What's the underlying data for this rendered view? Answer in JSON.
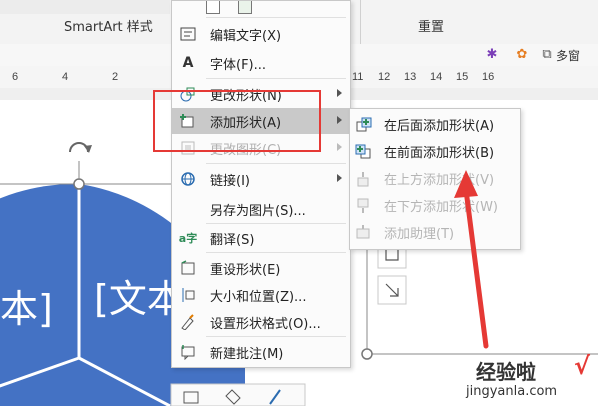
{
  "ribbon": {
    "group_smartart_styles": "SmartArt 样式",
    "group_reset": "重置",
    "more_windows": "多窗"
  },
  "ruler": {
    "left_ticks": [
      "6",
      "4",
      "2"
    ],
    "right_ticks": [
      "11",
      "12",
      "13",
      "14",
      "15",
      "16"
    ]
  },
  "slide": {
    "text_left": "本]",
    "text_right": "[文本"
  },
  "context_menu": {
    "items": [
      {
        "icon": "edit-text-icon",
        "label": "编辑文字(X)",
        "enabled": true,
        "submenu": false
      },
      {
        "icon": "font-icon",
        "label": "字体(F)...",
        "enabled": true,
        "submenu": false
      },
      {
        "icon": "change-shape-icon",
        "label": "更改形状(N)",
        "enabled": true,
        "submenu": true
      },
      {
        "icon": "add-shape-icon",
        "label": "添加形状(A)",
        "enabled": true,
        "submenu": true,
        "highlighted": true
      },
      {
        "icon": "change-graphic-icon",
        "label": "更改图形(C)",
        "enabled": false,
        "submenu": true
      },
      {
        "icon": "link-icon",
        "label": "链接(I)",
        "enabled": true,
        "submenu": true
      },
      {
        "icon": "none",
        "label": "另存为图片(S)...",
        "enabled": true,
        "submenu": false
      },
      {
        "icon": "translate-icon",
        "label": "翻译(S)",
        "enabled": true,
        "submenu": false
      },
      {
        "icon": "reset-shape-icon",
        "label": "重设形状(E)",
        "enabled": true,
        "submenu": false
      },
      {
        "icon": "size-position-icon",
        "label": "大小和位置(Z)...",
        "enabled": true,
        "submenu": false
      },
      {
        "icon": "format-shape-icon",
        "label": "设置形状格式(O)...",
        "enabled": true,
        "submenu": false
      },
      {
        "icon": "new-comment-icon",
        "label": "新建批注(M)",
        "enabled": true,
        "submenu": false
      }
    ]
  },
  "submenu": {
    "items": [
      {
        "icon": "add-after-icon",
        "label": "在后面添加形状(A)",
        "enabled": true
      },
      {
        "icon": "add-before-icon",
        "label": "在前面添加形状(B)",
        "enabled": true
      },
      {
        "icon": "add-above-icon",
        "label": "在上方添加形状(V)",
        "enabled": false
      },
      {
        "icon": "add-below-icon",
        "label": "在下方添加形状(W)",
        "enabled": false
      },
      {
        "icon": "add-assistant-icon",
        "label": "添加助理(T)",
        "enabled": false
      }
    ]
  },
  "watermark": {
    "text": "经验啦",
    "url": "jingyanla.com",
    "check": "√"
  },
  "colors": {
    "smartart_blue": "#4472c4",
    "highlight_red": "#e53935",
    "menu_highlight": "#c9c9c9",
    "icon_green": "#2e8b57",
    "icon_blue": "#2b6cb0"
  }
}
